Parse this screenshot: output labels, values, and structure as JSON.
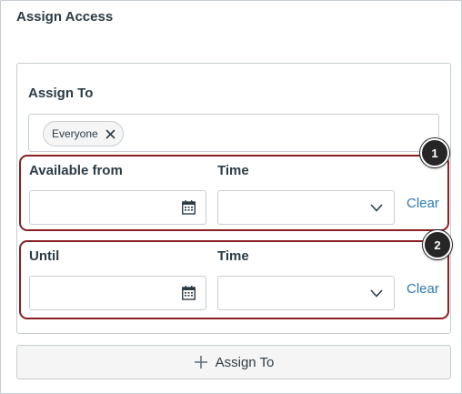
{
  "panel": {
    "title": "Assign Access"
  },
  "assign": {
    "label": "Assign To",
    "pills": [
      {
        "label": "Everyone",
        "remove_icon": "close-icon"
      }
    ]
  },
  "available": {
    "label": "Available from",
    "date_value": "",
    "time_label": "Time",
    "time_value": "",
    "clear_label": "Clear",
    "badge": "1"
  },
  "until": {
    "label": "Until",
    "date_value": "",
    "time_label": "Time",
    "time_value": "",
    "clear_label": "Clear",
    "badge": "2"
  },
  "add_button": {
    "label": "Assign To",
    "icon": "plus-icon"
  },
  "colors": {
    "text": "#2d3b45",
    "link": "#2b7abc",
    "highlight": "#8a1f24",
    "badge": "#262626",
    "border": "#c7cdd1"
  }
}
